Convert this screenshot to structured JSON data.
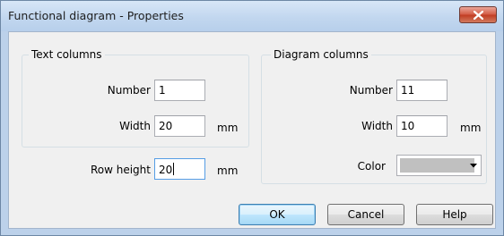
{
  "window": {
    "title": "Functional diagram - Properties",
    "close_icon": "close-icon"
  },
  "text_columns": {
    "title": "Text columns",
    "number_label": "Number",
    "number_value": "1",
    "width_label": "Width",
    "width_value": "20",
    "width_unit": "mm"
  },
  "row_height": {
    "label": "Row height",
    "value": "20",
    "unit": "mm"
  },
  "diagram_columns": {
    "title": "Diagram columns",
    "number_label": "Number",
    "number_value": "11",
    "width_label": "Width",
    "width_value": "10",
    "width_unit": "mm",
    "color_label": "Color",
    "color_value": "#c0c0c0"
  },
  "buttons": {
    "ok": "OK",
    "cancel": "Cancel",
    "help": "Help"
  }
}
